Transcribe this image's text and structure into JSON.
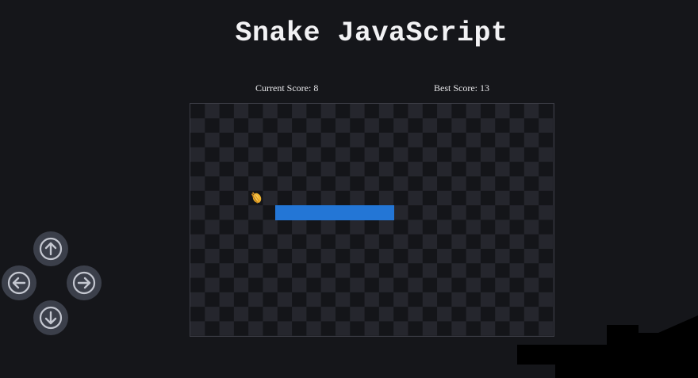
{
  "title": "Snake JavaScript",
  "scores": {
    "current": "Current Score: 8",
    "best": "Best Score: 13"
  },
  "game": {
    "snake_color": "#2376d6",
    "food_icon": "corn-icon",
    "board_light": "#25262d",
    "board_dark": "#141519"
  },
  "controls": [
    {
      "icon": "arrow-up-icon"
    },
    {
      "icon": "arrow-left-icon"
    },
    {
      "icon": "arrow-right-icon"
    },
    {
      "icon": "arrow-down-icon"
    }
  ],
  "colors": {
    "background": "#15161a",
    "button": "#3b3f4a",
    "button_glyph": "#c4c7d0"
  }
}
